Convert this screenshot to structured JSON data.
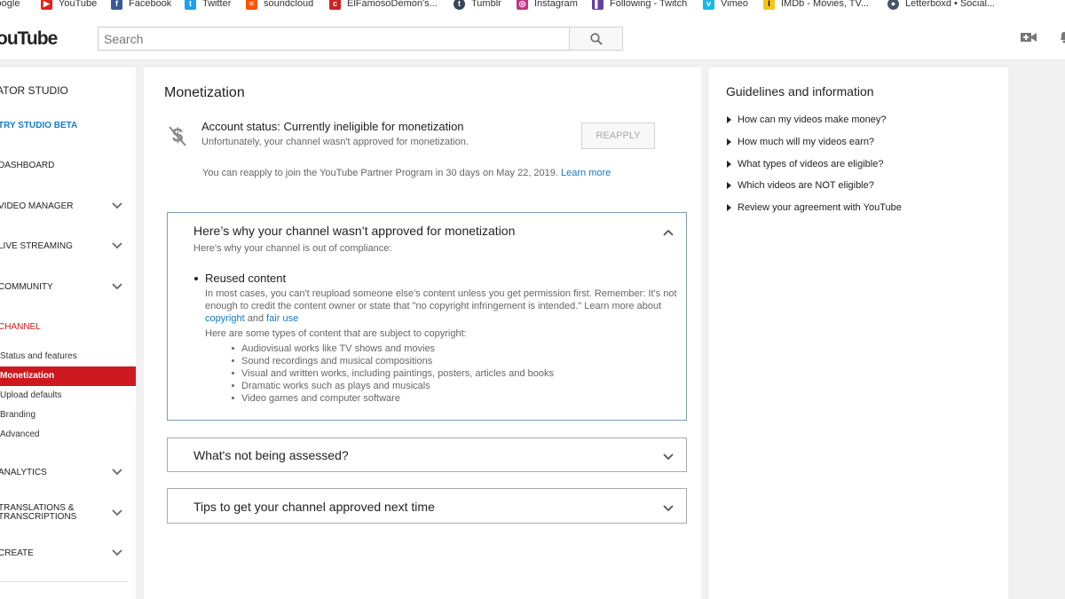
{
  "bookmarks": [
    {
      "label": "Google",
      "icon": "google-icon",
      "color": "#ffffff"
    },
    {
      "label": "YouTube",
      "icon": "youtube-icon",
      "color": "#e62117"
    },
    {
      "label": "Facebook",
      "icon": "facebook-icon",
      "color": "#3b5998"
    },
    {
      "label": "Twitter",
      "icon": "twitter-icon",
      "color": "#1da1f2"
    },
    {
      "label": "soundcloud",
      "icon": "soundcloud-icon",
      "color": "#ff5500"
    },
    {
      "label": "ElFamosoDemon's...",
      "icon": "cs-icon",
      "color": "#cc2222"
    },
    {
      "label": "Tumblr",
      "icon": "tumblr-icon",
      "color": "#35465c"
    },
    {
      "label": "Instagram",
      "icon": "instagram-icon",
      "color": "#c13584"
    },
    {
      "label": "Following - Twitch",
      "icon": "twitch-icon",
      "color": "#6441a5"
    },
    {
      "label": "Vimeo",
      "icon": "vimeo-icon",
      "color": "#1ab7ea"
    },
    {
      "label": "IMDb - Movies, TV...",
      "icon": "imdb-icon",
      "color": "#f5c518"
    },
    {
      "label": "Letterboxd • Social...",
      "icon": "letterboxd-icon",
      "color": "#445566"
    }
  ],
  "masthead": {
    "logo": "ouTube",
    "search_placeholder": "Search"
  },
  "sidebar": {
    "studio_title": "ATOR STUDIO",
    "try_beta": "TRY STUDIO BETA",
    "dashboard": "DASHBOARD",
    "video_manager": "VIDEO MANAGER",
    "live_streaming": "LIVE STREAMING",
    "community": "COMMUNITY",
    "channel": "CHANNEL",
    "channel_items": [
      "Status and features",
      "Monetization",
      "Upload defaults",
      "Branding",
      "Advanced"
    ],
    "analytics": "ANALYTICS",
    "translations_1": "TRANSLATIONS &",
    "translations_2": "TRANSCRIPTIONS",
    "create": "CREATE",
    "active_color": "#cc181e",
    "beta_color": "#167ac6"
  },
  "main": {
    "title": "Monetization",
    "status": "Account status: Currently ineligible for monetization",
    "status_sub": "Unfortunately, your channel wasn't approved for monetization.",
    "reapply_button": "REAPPLY",
    "reapply_note": "You can reapply to join the YouTube Partner Program in 30 days on May 22, 2019.",
    "learn_more": "Learn more",
    "panel1": {
      "heading": "Here’s why your channel wasn’t approved for monetization",
      "sub": "Here's why your channel is out of compliance:",
      "bullet": "Reused content",
      "body_1": "In most cases, you can't reupload someone else's content unless you get permission first. Remember: It's not enough to credit the content owner or state that \"no copyright infringement is intended.\" Learn more about",
      "copyright_link": "copyright",
      "and": "and",
      "fair_use_link": "fair use",
      "types_intro": "Here are some types of content that are subject to copyright:",
      "types": [
        "Audiovisual works like TV shows and movies",
        "Sound recordings and musical compositions",
        "Visual and written works, including paintings, posters, articles and books",
        "Dramatic works such as plays and musicals",
        "Video games and computer software"
      ]
    },
    "panel2": {
      "heading": "What's not being assessed?"
    },
    "panel3": {
      "heading": "Tips to get your channel approved next time"
    }
  },
  "guidelines": {
    "title": "Guidelines and information",
    "items": [
      "How can my videos make money?",
      "How much will my videos earn?",
      "What types of videos are eligible?",
      "Which videos are NOT eligible?",
      "Review your agreement with YouTube"
    ]
  }
}
